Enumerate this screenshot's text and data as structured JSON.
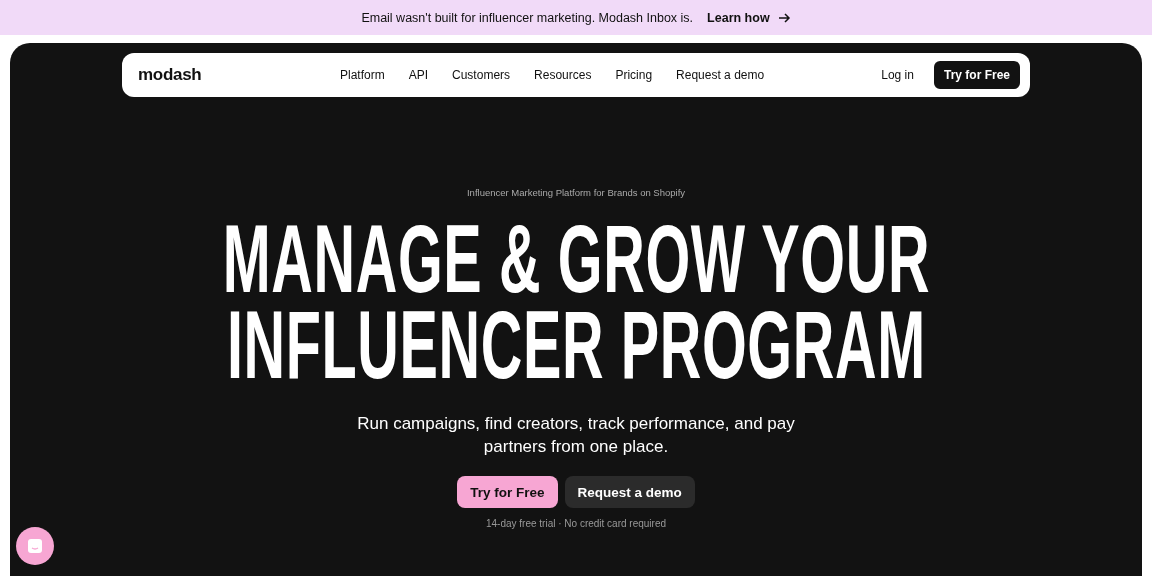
{
  "banner": {
    "text": "Email wasn't built for influencer marketing. Modash Inbox is.",
    "link": "Learn how"
  },
  "nav": {
    "logo": "modash",
    "links": [
      "Platform",
      "API",
      "Customers",
      "Resources",
      "Pricing",
      "Request a demo"
    ],
    "login": "Log in",
    "cta": "Try for Free"
  },
  "hero": {
    "eyebrow": "Influencer Marketing Platform for Brands on Shopify",
    "headline": [
      "MANAGE & GROW YOUR",
      "INFLUENCER PROGRAM"
    ],
    "subtitle": "Run campaigns, find creators, track performance, and pay partners from one place.",
    "buttons": [
      {
        "label": "Try for Free",
        "kind": "primary"
      },
      {
        "label": "Request a demo",
        "kind": "secondary"
      }
    ],
    "note": "14-day free trial · No credit card required"
  }
}
